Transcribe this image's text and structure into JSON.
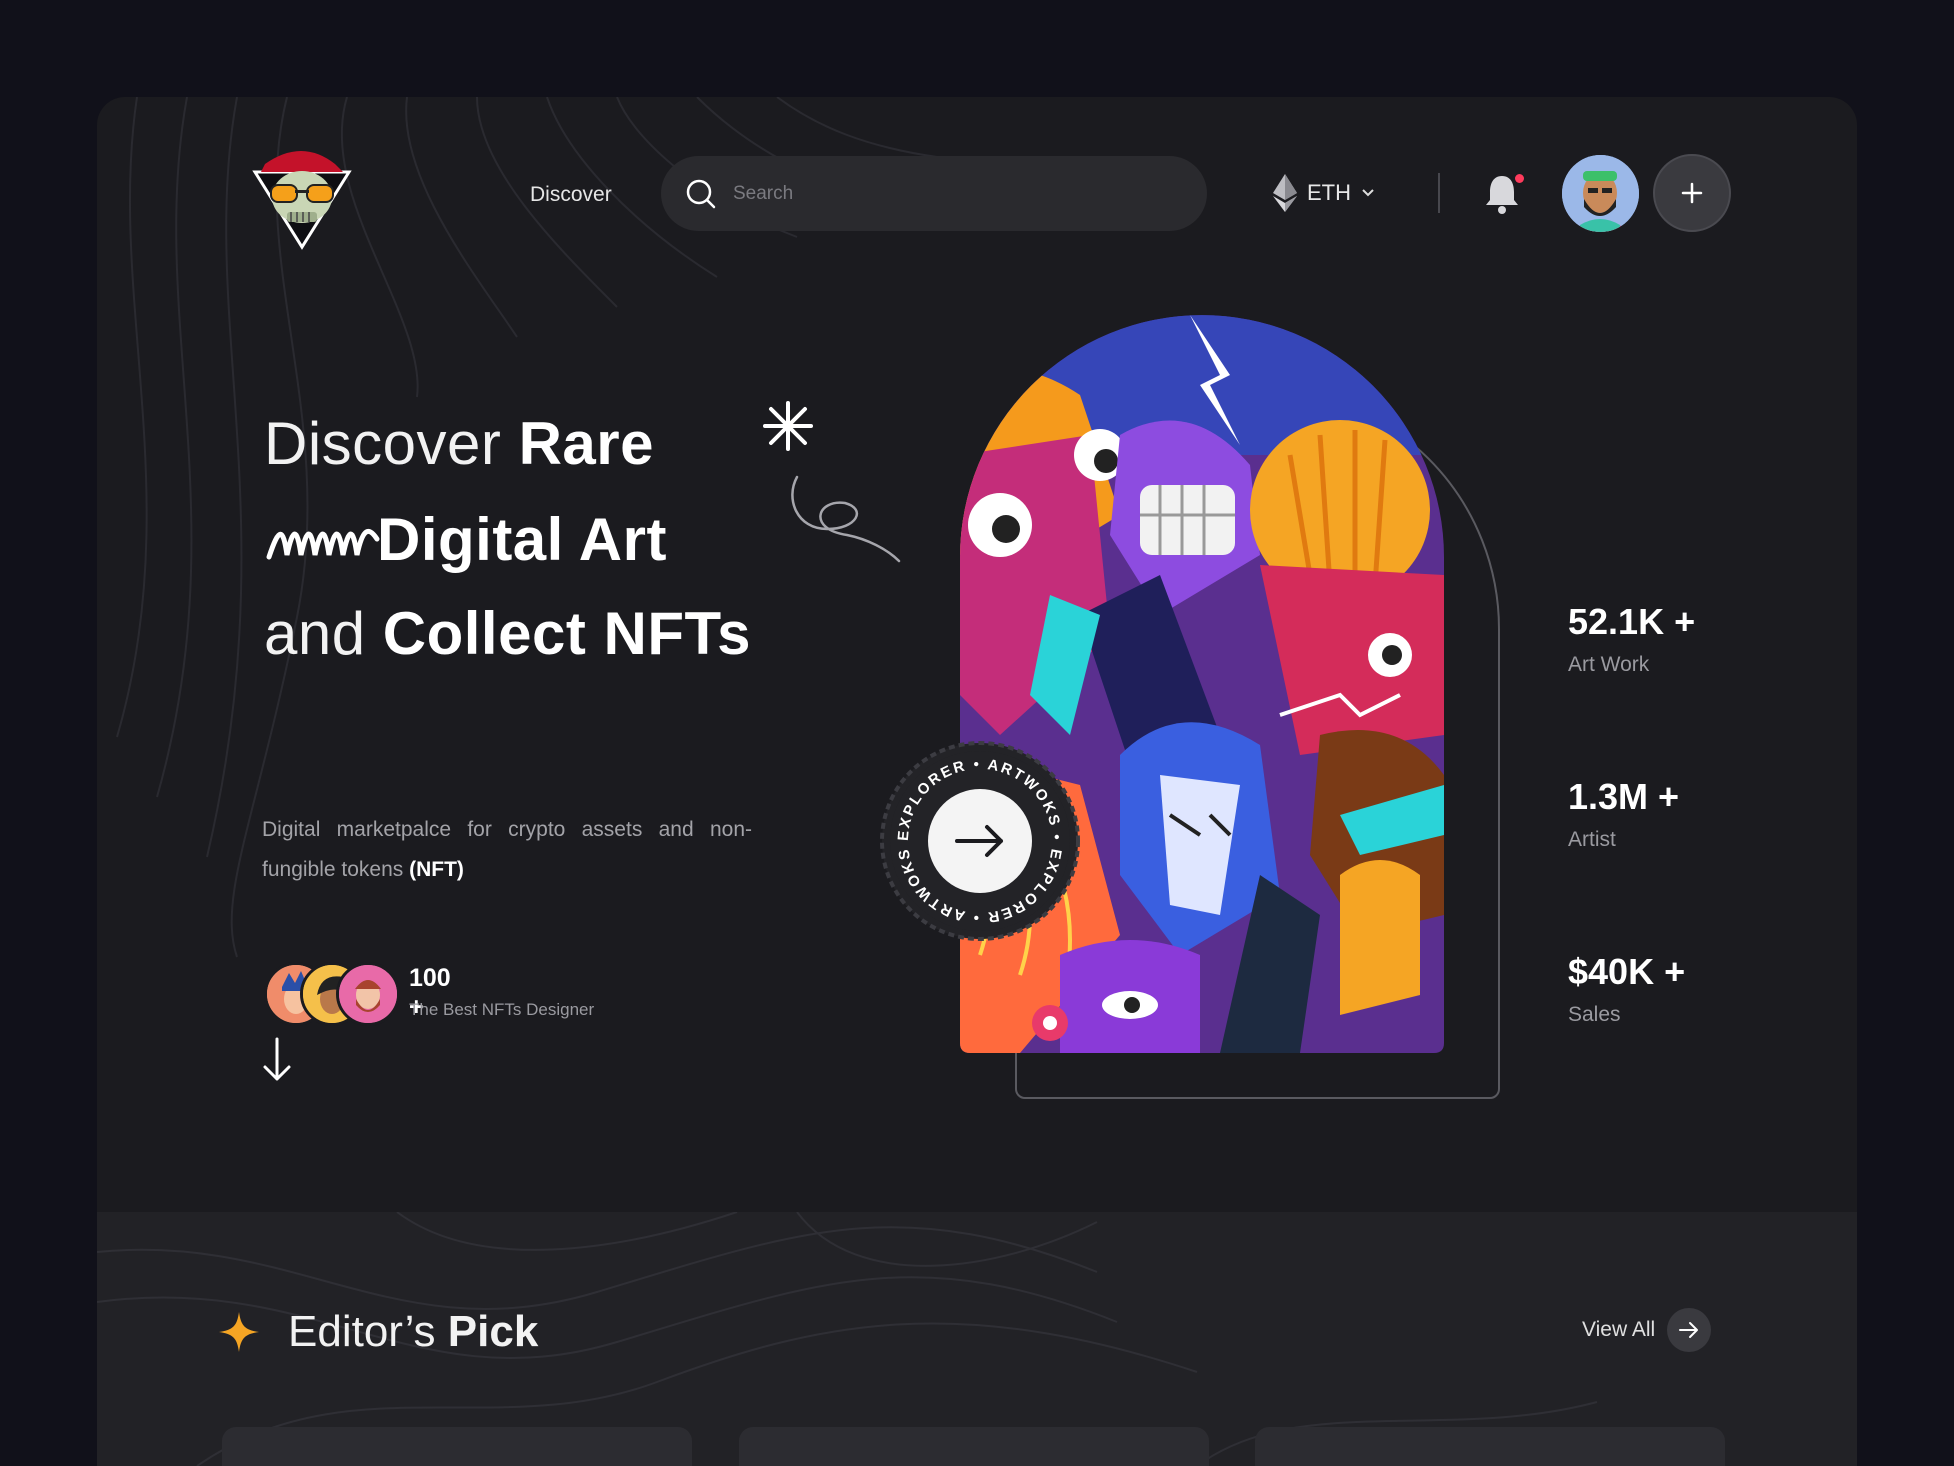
{
  "header": {
    "nav_discover": "Discover",
    "search_placeholder": "Search",
    "currency": "ETH",
    "notification_dot_color": "#ff3b5c"
  },
  "hero": {
    "line1_thin": "Discover ",
    "line1_bold": "Rare",
    "line2_bold": "Digital Art",
    "line3_thin": "and ",
    "line3_bold": "Collect NFTs",
    "description": "Digital marketpalce for crypto assets and non-fungible tokens ",
    "description_strong": "(NFT)",
    "designers_count": "100 +",
    "designers_label": "The Best NFTs Designer",
    "badge_text": "EXPLORER • ARTWOKS • EXPLORER • ARTWOKS •"
  },
  "stats": [
    {
      "value": "52.1K +",
      "label": "Art Work"
    },
    {
      "value": "1.3M +",
      "label": "Artist"
    },
    {
      "value": "$40K +",
      "label": "Sales"
    }
  ],
  "editors_pick": {
    "title_thin": "Editor’s ",
    "title_bold": "Pick",
    "view_all": "View All",
    "accent_color": "#f5a524"
  }
}
